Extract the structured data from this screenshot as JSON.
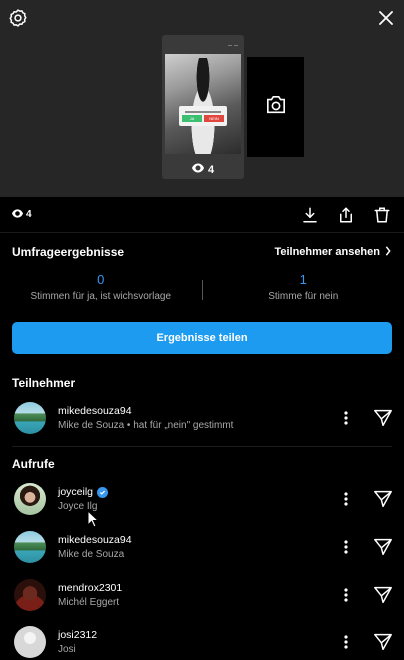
{
  "story": {
    "views_count": "4",
    "poll_yes": "JA",
    "poll_no": "NEIN"
  },
  "actions": {
    "views_count": "4"
  },
  "poll": {
    "title": "Umfrageergebnisse",
    "see_participants": "Teilnehmer ansehen",
    "results": [
      {
        "count": "0",
        "label": "Stimmen für ja, ist wichsvorlage"
      },
      {
        "count": "1",
        "label": "Stimme für nein"
      }
    ],
    "share_button": "Ergebnisse teilen"
  },
  "participants": {
    "title": "Teilnehmer",
    "items": [
      {
        "username": "mikedesouza94",
        "subtitle": "Mike de Souza • hat für „nein\" gestimmt"
      }
    ]
  },
  "views": {
    "title": "Aufrufe",
    "items": [
      {
        "username": "joyceilg",
        "subtitle": "Joyce Ilg",
        "verified": true
      },
      {
        "username": "mikedesouza94",
        "subtitle": "Mike de Souza",
        "verified": false
      },
      {
        "username": "mendrox2301",
        "subtitle": "Michél Eggert",
        "verified": false
      },
      {
        "username": "josi2312",
        "subtitle": "Josi",
        "verified": false
      }
    ]
  },
  "icons": {
    "settings": "gear-icon",
    "close": "close-icon",
    "camera": "camera-icon",
    "views": "eye-icon",
    "download": "download-icon",
    "share": "share-icon",
    "delete": "trash-icon",
    "chevron": "chevron-right-icon",
    "more": "more-vertical-icon",
    "send": "send-icon",
    "verified": "verified-badge-icon"
  },
  "colors": {
    "accent": "#3897f0",
    "button": "#1d9bf0",
    "background": "#000000",
    "preview_bg": "#262626",
    "secondary_text": "#a8a8a8"
  }
}
